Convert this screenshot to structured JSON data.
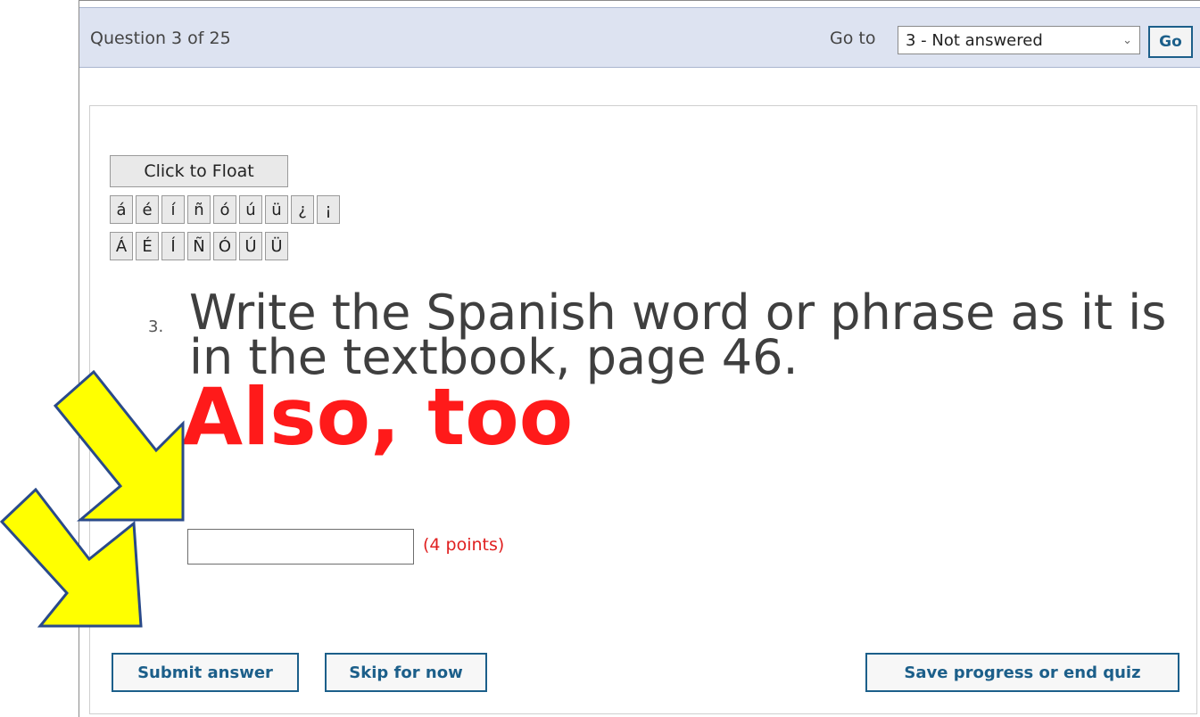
{
  "header": {
    "question_counter": "Question 3 of 25",
    "goto_label": "Go to",
    "goto_selected": "3 - Not answered",
    "go_button": "Go"
  },
  "toolbar": {
    "float_button": "Click to Float",
    "accent_row1": [
      "á",
      "é",
      "í",
      "ñ",
      "ó",
      "ú",
      "ü",
      "¿",
      "¡"
    ],
    "accent_row2": [
      "Á",
      "É",
      "Í",
      "Ñ",
      "Ó",
      "Ú",
      "Ü"
    ]
  },
  "question": {
    "number": "3.",
    "text": "Write the Spanish word or phrase as it is in the textbook, page 46.",
    "answer_hint": "Also, too",
    "input_value": "",
    "points": "(4 points)"
  },
  "actions": {
    "submit": "Submit answer",
    "skip": "Skip for now",
    "save": "Save progress or end quiz"
  },
  "colors": {
    "header_bg": "#dde3f1",
    "button_border": "#1c5f8a",
    "hint_red": "#ff1a1a",
    "arrow_fill": "#ffff00",
    "arrow_stroke": "#2a4a8a"
  },
  "icons": {
    "annotation_arrows": "arrow-down-right-icon",
    "select_chevron": "chevron-down-icon"
  }
}
